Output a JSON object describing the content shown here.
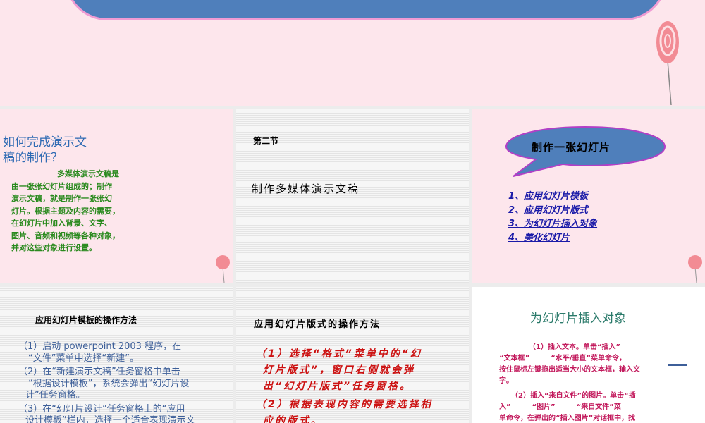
{
  "slide2": {
    "title_line1": "如何完成演示文",
    "title_line2": "稿的制作？",
    "body": [
      "多媒体演示文稿是",
      "由一张张幻灯片组成的；制作",
      "演示文稿，就是制作一张张幻",
      "灯片。根据主题及内容的需要，",
      "在幻灯片中加入背景、文字、",
      "图片、音频和视频等各种对象，",
      "并对这些对象进行设置。"
    ]
  },
  "slide3": {
    "section": "第二节",
    "title": "制作多媒体演示文稿"
  },
  "slide4": {
    "bubble": "制作一张幻灯片",
    "links": [
      "1、应用幻灯片模板",
      "2、应用幻灯片版式",
      "3、为幻灯片插入对象",
      "4、美化幻灯片"
    ]
  },
  "slide5": {
    "title": "应用幻灯片模板的操作方法",
    "lines": [
      "（1）启动 powerpoint 2003 程序，在",
      "“文件”菜单中选择“新建”。",
      "（2）在“新建演示文稿”任务窗格中单击",
      "“根据设计模板”，系统会弹出“幻灯片设",
      "计”任务窗格。",
      "（3）在“幻灯片设计”任务窗格上的“应用",
      "设计模板”栏内，选择一个适合表现演示文"
    ]
  },
  "slide6": {
    "title": "应用幻灯片版式的操作方法",
    "lines": [
      "（1）选择“格式”菜单中的“幻",
      "灯片版式”，窗口右侧就会弹",
      "出“幻灯片版式”任务窗格。",
      "（2）根据表现内容的需要选择相",
      "应的版式。"
    ]
  },
  "slide7": {
    "title": "为幻灯片插入对象",
    "lines": [
      "（1）插入文本。单击“插入”",
      "“文本框”　　　“水平/垂直”菜单命令，",
      "按住鼠标左键拖出适当大小的文本框，输入文",
      "字。",
      "（2）插入“来自文件”的图片。单击“插",
      "入”　　　“图片”　　　“来自文件”菜",
      "单命令，在弹出的“插入图片”对话框中，找"
    ]
  }
}
